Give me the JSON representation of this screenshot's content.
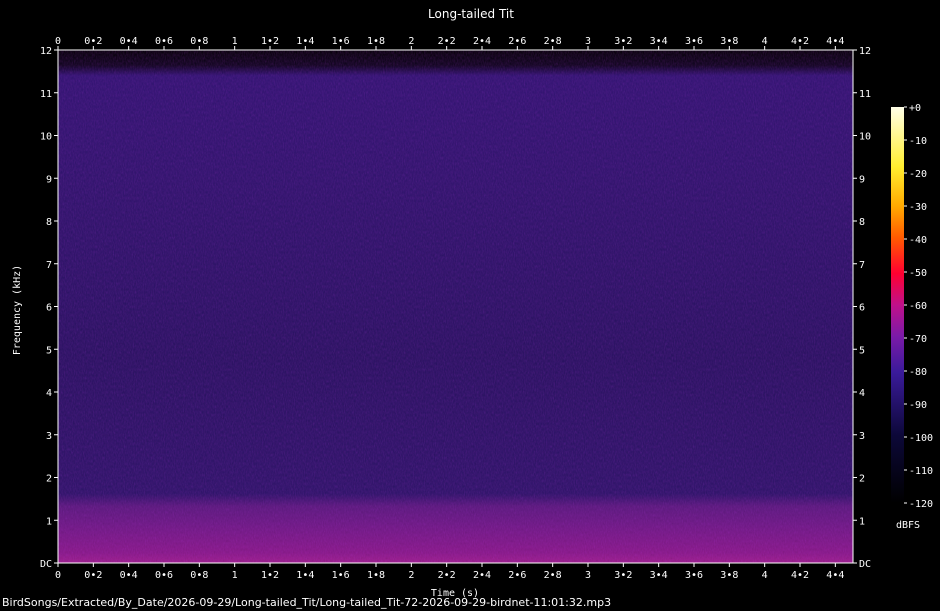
{
  "chart_data": {
    "type": "heatmap",
    "title": "Long-tailed Tit",
    "xlabel": "Time (s)",
    "ylabel": "Frequency (kHz)",
    "xlim": [
      0,
      4.5
    ],
    "ylim": [
      0,
      12
    ],
    "x_ticks": [
      "0",
      "0•2",
      "0•4",
      "0•6",
      "0•8",
      "1",
      "1•2",
      "1•4",
      "1•6",
      "1•8",
      "2",
      "2•2",
      "2•4",
      "2•6",
      "2•8",
      "3",
      "3•2",
      "3•4",
      "3•6",
      "3•8",
      "4",
      "4•2",
      "4•4"
    ],
    "x_tick_values": [
      0,
      0.2,
      0.4,
      0.6,
      0.8,
      1.0,
      1.2,
      1.4,
      1.6,
      1.8,
      2.0,
      2.2,
      2.4,
      2.6,
      2.8,
      3.0,
      3.2,
      3.4,
      3.6,
      3.8,
      4.0,
      4.2,
      4.4
    ],
    "y_ticks": [
      "DC",
      "1",
      "2",
      "3",
      "4",
      "5",
      "6",
      "7",
      "8",
      "9",
      "10",
      "11",
      "12"
    ],
    "y_tick_values": [
      0,
      1,
      2,
      3,
      4,
      5,
      6,
      7,
      8,
      9,
      10,
      11,
      12
    ],
    "colorbar": {
      "label": "dBFS",
      "ticks": [
        "+0",
        "-10",
        "-20",
        "-30",
        "-40",
        "-50",
        "-60",
        "-70",
        "-80",
        "-90",
        "-100",
        "-110",
        "-120"
      ],
      "range": [
        -120,
        0
      ]
    },
    "signal_bands": [
      {
        "freq_khz": [
          0,
          1.6
        ],
        "level_dbfs": -75
      },
      {
        "freq_khz": [
          1.6,
          11.6
        ],
        "level_dbfs": -95
      }
    ]
  },
  "footer": {
    "filename": "BirdSongs/Extracted/By_Date/2026-09-29/Long-tailed_Tit/Long-tailed_Tit-72-2026-09-29-birdnet-11:01:32.mp3"
  }
}
